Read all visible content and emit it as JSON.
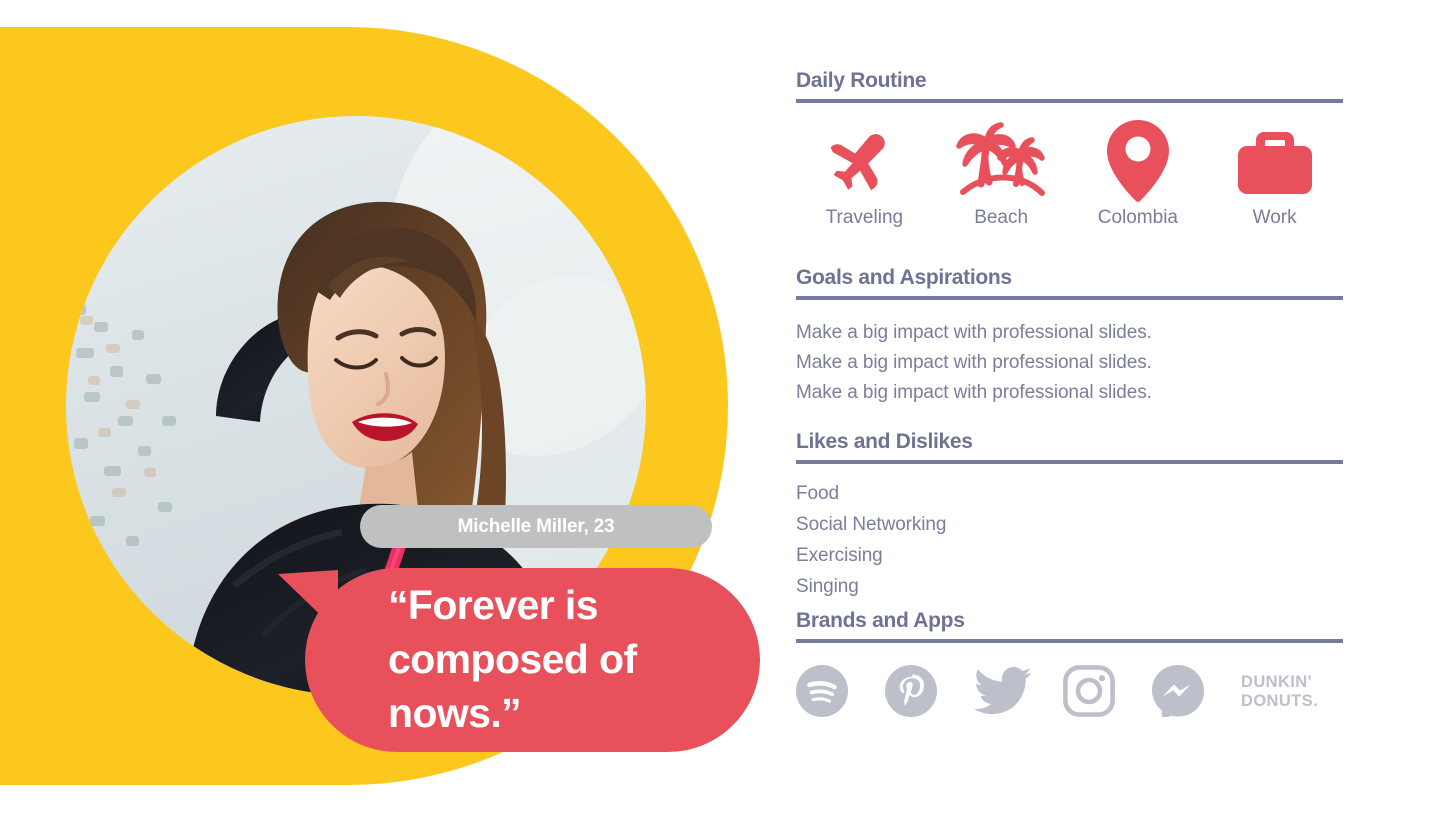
{
  "colors": {
    "yellow": "#FDC81E",
    "coral": "#E8505B",
    "heading": "#6F7293",
    "rule": "#7679A0",
    "body": "#7B7E9A",
    "pill_gray": "#BFC0C2",
    "brand_gray": "#BDBFCB"
  },
  "profile": {
    "name_age": "Michelle Miller, 23",
    "quote": "“Forever is composed of nows.”",
    "photo_alt": "smiling-woman-portrait"
  },
  "sections": {
    "daily_routine": {
      "heading": "Daily Routine",
      "items": [
        {
          "label": "Traveling",
          "icon": "airplane-icon"
        },
        {
          "label": "Beach",
          "icon": "palm-trees-icon"
        },
        {
          "label": "Colombia",
          "icon": "location-pin-icon"
        },
        {
          "label": "Work",
          "icon": "briefcase-icon"
        }
      ]
    },
    "goals": {
      "heading": "Goals and Aspirations",
      "lines": [
        "Make a big impact with professional slides.",
        "Make a big impact with professional slides.",
        "Make a big impact with professional slides."
      ]
    },
    "likes": {
      "heading": "Likes and Dislikes",
      "lines": [
        "Food",
        "Social Networking",
        "Exercising",
        "Singing"
      ]
    },
    "brands": {
      "heading": "Brands and Apps",
      "items": [
        {
          "name": "Spotify",
          "icon": "spotify-icon"
        },
        {
          "name": "Pinterest",
          "icon": "pinterest-icon"
        },
        {
          "name": "Twitter",
          "icon": "twitter-icon"
        },
        {
          "name": "Instagram",
          "icon": "instagram-icon"
        },
        {
          "name": "Messenger",
          "icon": "messenger-icon"
        },
        {
          "name": "Dunkin' Donuts",
          "icon": "dunkin-donuts-wordmark"
        }
      ]
    }
  }
}
